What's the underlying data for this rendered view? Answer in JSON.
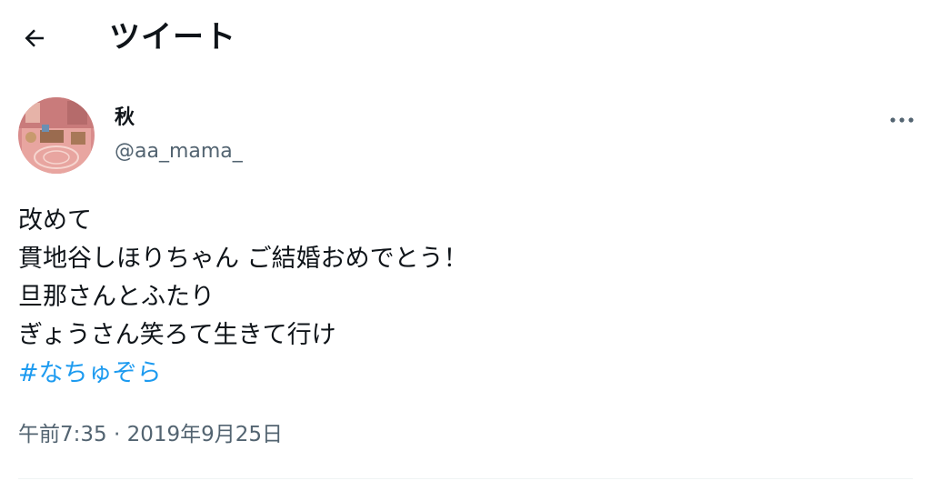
{
  "header": {
    "title": "ツイート",
    "back_icon": "arrow-left-icon"
  },
  "author": {
    "display_name": "秋",
    "handle": "@aa_mama_",
    "avatar": "avatar-image"
  },
  "menu": {
    "icon": "more-horizontal-icon"
  },
  "tweet": {
    "lines": [
      "改めて",
      "貫地谷しほりちゃん ご結婚おめでとう！",
      "旦那さんとふたり",
      "ぎょうさん笑ろて生きて行け"
    ],
    "hashtag": "#なちゅぞら",
    "timestamp": "午前7:35 · 2019年9月25日"
  },
  "colors": {
    "text": "#0f1419",
    "secondary": "#536471",
    "link": "#1d9bf0"
  }
}
